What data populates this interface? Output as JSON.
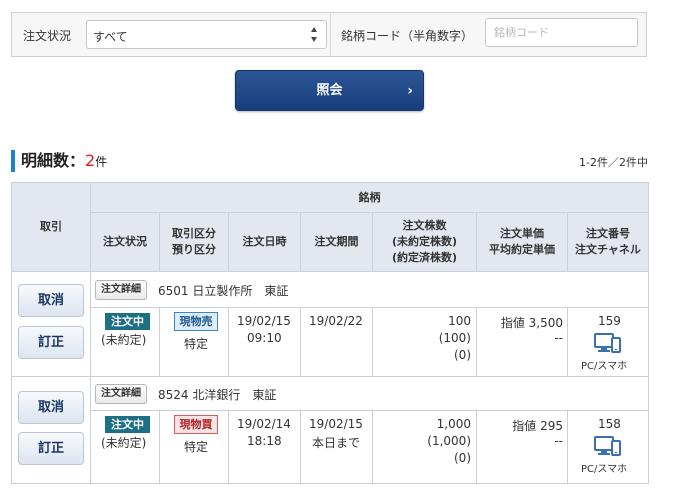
{
  "filter": {
    "status_label": "注文状況",
    "status_value": "すべて",
    "code_label": "銘柄コード（半角数字）",
    "code_placeholder": "銘柄コード"
  },
  "search_button": {
    "label": "照会",
    "icon": "chevron-right-icon"
  },
  "summary": {
    "label": "明細数：",
    "count": "2",
    "unit": "件",
    "paging": "1-2件／2件中"
  },
  "table": {
    "headers": {
      "trade": "取引",
      "stock": "銘柄",
      "status": "注文状況",
      "category_line1": "取引区分",
      "category_line2": "預り区分",
      "order_datetime": "注文日時",
      "period": "注文期間",
      "shares_line1": "注文株数",
      "shares_line2": "(未約定株数)",
      "shares_line3": "(約定済株数)",
      "price_line1": "注文単価",
      "price_line2": "平均約定単価",
      "order_no_line1": "注文番号",
      "order_no_line2": "注文チャネル"
    },
    "rows": [
      {
        "cancel_label": "取消",
        "modify_label": "訂正",
        "detail_label": "注文詳細",
        "stock": "6501 日立製作所　東証",
        "status_badge": "注文中",
        "status_sub": "(未約定)",
        "trade_type": "現物売",
        "account": "特定",
        "date": "19/02/15",
        "time": "09:10",
        "period_line1": "19/02/22",
        "period_line2": "",
        "shares": "100",
        "unfilled": "(100)",
        "filled": "(0)",
        "price": "指値 3,500",
        "avg_price": "--",
        "order_no": "159",
        "channel": "PC/スマホ"
      },
      {
        "cancel_label": "取消",
        "modify_label": "訂正",
        "detail_label": "注文詳細",
        "stock": "8524 北洋銀行　東証",
        "status_badge": "注文中",
        "status_sub": "(未約定)",
        "trade_type": "現物買",
        "account": "特定",
        "date": "19/02/14",
        "time": "18:18",
        "period_line1": "19/02/15",
        "period_line2": "本日まで",
        "shares": "1,000",
        "unfilled": "(1,000)",
        "filled": "(0)",
        "price": "指値 295",
        "avg_price": "--",
        "order_no": "158",
        "channel": "PC/スマホ"
      }
    ]
  },
  "colors": {
    "accent": "#1d80d6",
    "button": "#1f4684",
    "status_badge": "#1d6f87",
    "sell": "#3b86c4",
    "buy": "#d75a5a",
    "count": "#e02020"
  },
  "icons": {
    "select": "updown-arrows-icon",
    "channel": "pc-smartphone-icon"
  }
}
